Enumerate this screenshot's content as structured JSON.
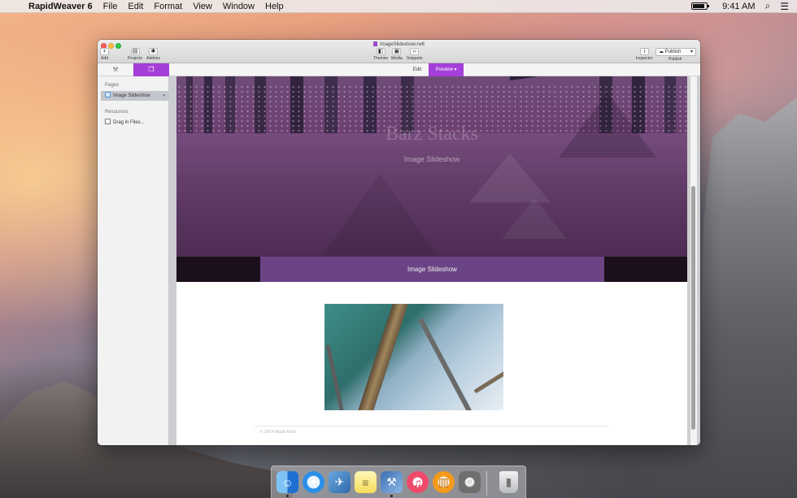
{
  "menubar": {
    "app_name": "RapidWeaver 6",
    "items": [
      "File",
      "Edit",
      "Format",
      "View",
      "Window",
      "Help"
    ],
    "clock": "9:41 AM"
  },
  "window": {
    "doc_title": "ImageSlideshow.rw6",
    "toolbar": {
      "add_label": "Add",
      "projects_label": "Projects",
      "addons_label": "Addons",
      "themes_label": "Themes",
      "media_label": "Media",
      "snippets_label": "Snippets",
      "inspector_label": "Inspector",
      "publish_button": "Publish",
      "publish_label": "Publish"
    },
    "tabs": {
      "edit": "Edit",
      "preview": "Preview"
    },
    "sidebar": {
      "pages_header": "Pages",
      "page_item": "Image Slideshow",
      "resources_header": "Resources",
      "resource_item": "Drag in Files..."
    }
  },
  "site": {
    "hero_title": "Barz Stacks",
    "hero_subtitle": "Image Slideshow",
    "nav_tab": "Image Slideshow",
    "footer": "© 2014 Maik Barz"
  },
  "dock": {
    "icons": [
      "finder-icon",
      "safari-icon",
      "preview-icon",
      "notes-icon",
      "xcode-icon",
      "itunes-icon",
      "ibooks-icon",
      "system-preferences-icon",
      "trash-icon"
    ]
  }
}
